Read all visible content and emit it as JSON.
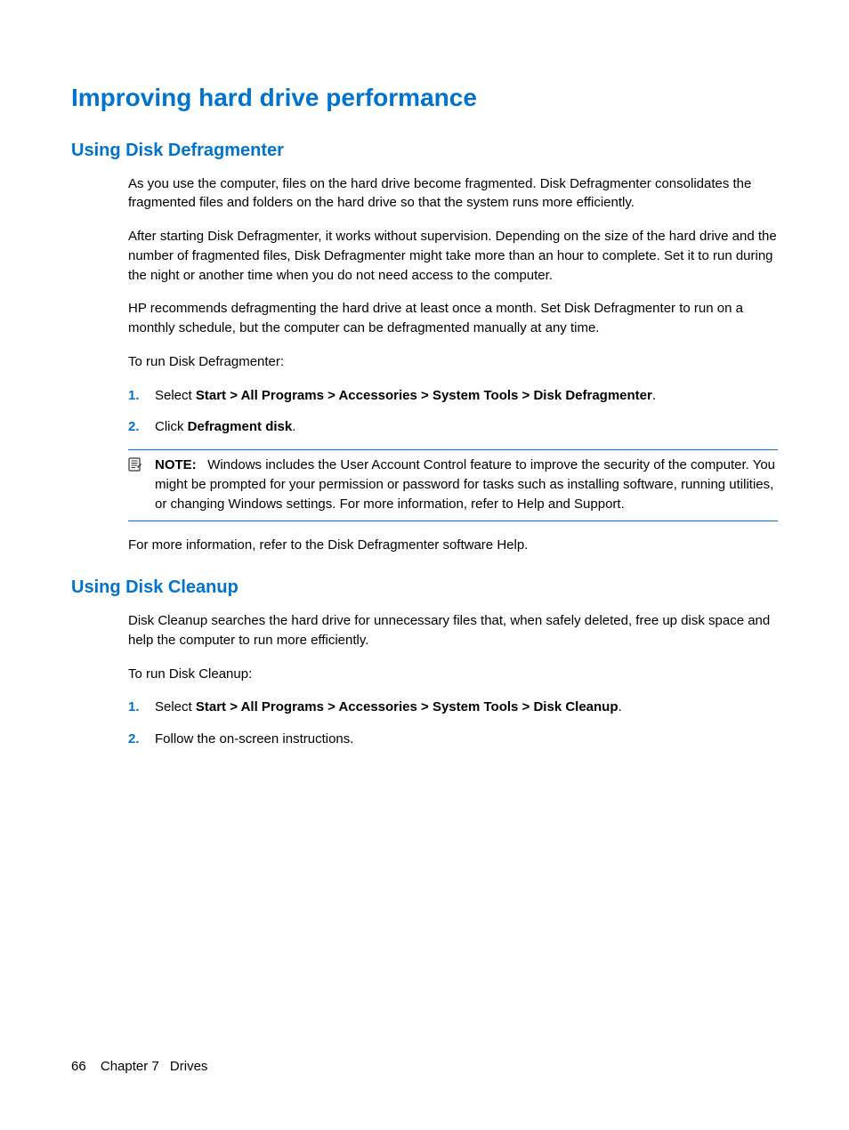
{
  "h1": "Improving hard drive performance",
  "section1": {
    "heading": "Using Disk Defragmenter",
    "p1": "As you use the computer, files on the hard drive become fragmented. Disk Defragmenter consolidates the fragmented files and folders on the hard drive so that the system runs more efficiently.",
    "p2": "After starting Disk Defragmenter, it works without supervision. Depending on the size of the hard drive and the number of fragmented files, Disk Defragmenter might take more than an hour to complete. Set it to run during the night or another time when you do not need access to the computer.",
    "p3": "HP recommends defragmenting the hard drive at least once a month. Set Disk Defragmenter to run on a monthly schedule, but the computer can be defragmented manually at any time.",
    "p4": "To run Disk Defragmenter:",
    "step1": {
      "num": "1.",
      "pre": "Select ",
      "bold": "Start > All Programs > Accessories > System Tools > Disk Defragmenter",
      "post": "."
    },
    "step2": {
      "num": "2.",
      "pre": "Click ",
      "bold": "Defragment disk",
      "post": "."
    },
    "note": {
      "label": "NOTE:",
      "text": "Windows includes the User Account Control feature to improve the security of the computer. You might be prompted for your permission or password for tasks such as installing software, running utilities, or changing Windows settings. For more information, refer to Help and Support."
    },
    "p5": "For more information, refer to the Disk Defragmenter software Help."
  },
  "section2": {
    "heading": "Using Disk Cleanup",
    "p1": "Disk Cleanup searches the hard drive for unnecessary files that, when safely deleted, free up disk space and help the computer to run more efficiently.",
    "p2": "To run Disk Cleanup:",
    "step1": {
      "num": "1.",
      "pre": "Select ",
      "bold": "Start > All Programs > Accessories > System Tools > Disk Cleanup",
      "post": "."
    },
    "step2": {
      "num": "2.",
      "text": "Follow the on-screen instructions."
    }
  },
  "footer": {
    "page": "66",
    "chapter": "Chapter 7",
    "title": "Drives"
  }
}
